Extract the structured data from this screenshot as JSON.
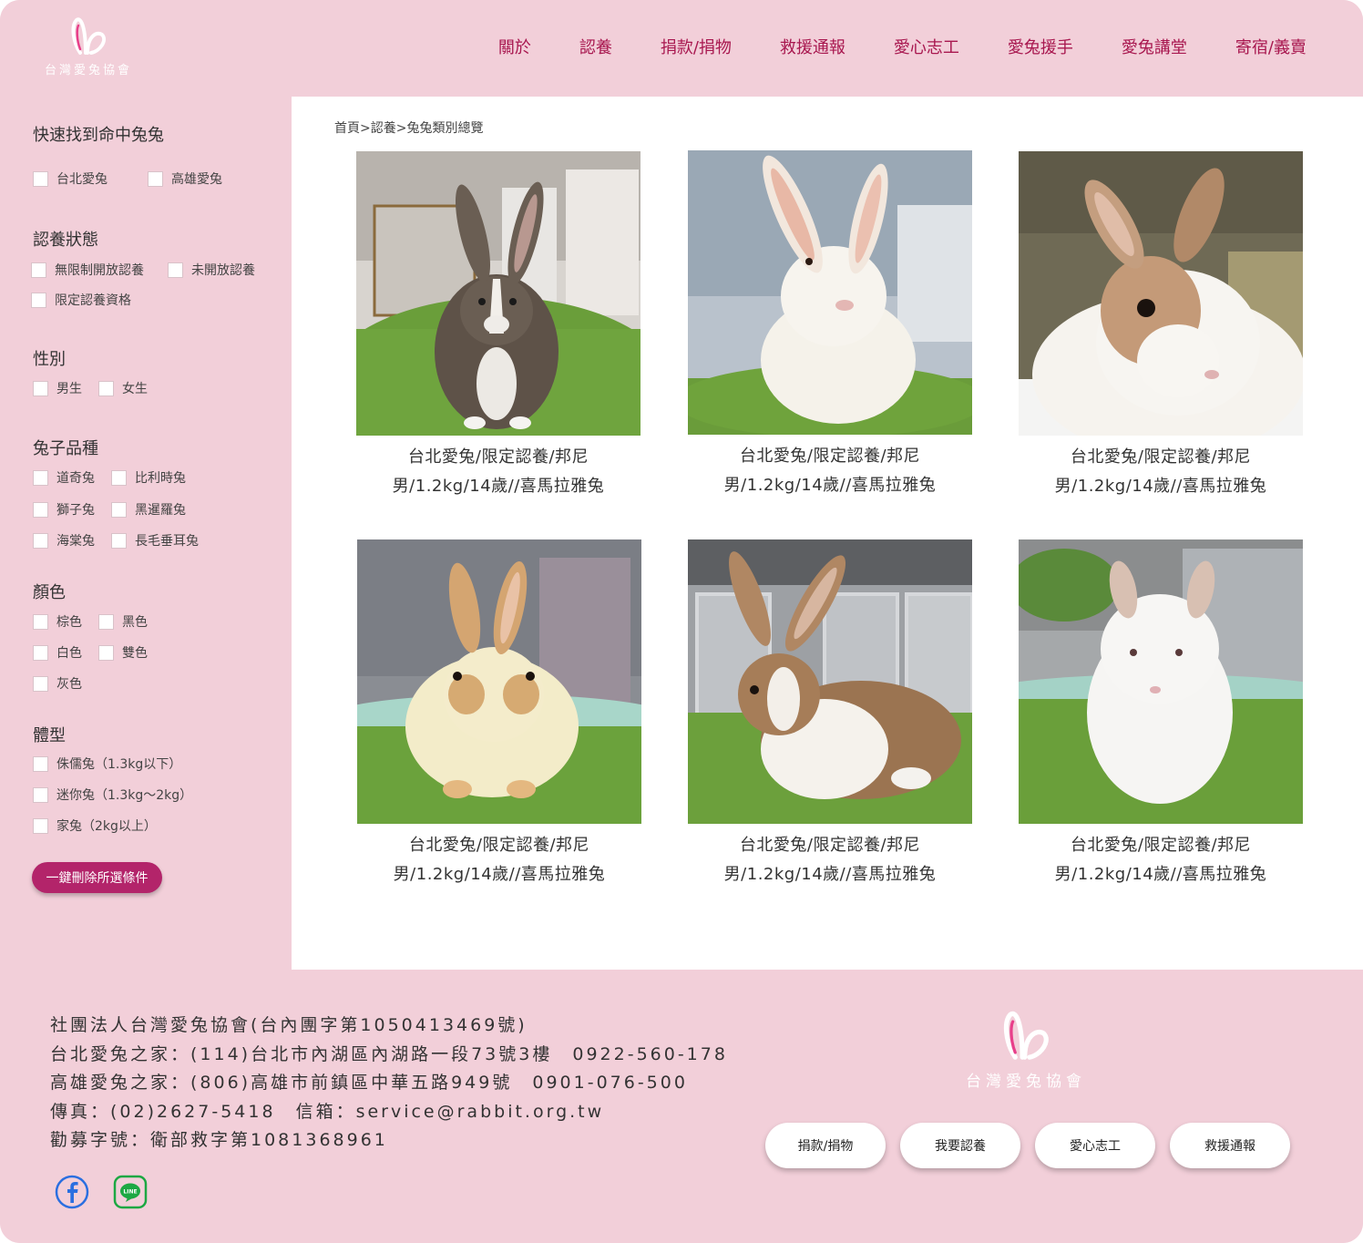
{
  "brand": {
    "name": "台灣愛兔協會",
    "accent": "#a8174f",
    "background": "#f2cfd9",
    "button_color": "#b3246a"
  },
  "nav": [
    "關於",
    "認養",
    "捐款/捐物",
    "救援通報",
    "愛心志工",
    "愛兔援手",
    "愛兔講堂",
    "寄宿/義賣"
  ],
  "breadcrumb": "首頁>認養>兔兔類別總覽",
  "filters": {
    "location": {
      "title": "快速找到命中兔兔",
      "options": [
        "台北愛兔",
        "高雄愛兔"
      ]
    },
    "status": {
      "title": "認養狀態",
      "options": [
        "無限制開放認養",
        "未開放認養",
        "限定認養資格"
      ]
    },
    "gender": {
      "title": "性別",
      "options": [
        "男生",
        "女生"
      ]
    },
    "breed": {
      "title": "兔子品種",
      "options": [
        "道奇兔",
        "比利時兔",
        "獅子兔",
        "黑暹羅兔",
        "海棠兔",
        "長毛垂耳兔"
      ]
    },
    "color": {
      "title": "顏色",
      "options": [
        "棕色",
        "黑色",
        "白色",
        "雙色",
        "灰色"
      ]
    },
    "size": {
      "title": "體型",
      "options": [
        "侏儒兔（1.3kg以下）",
        "迷你兔（1.3kg～2kg）",
        "家兔（2kg以上）"
      ]
    },
    "clear_label": "一鍵刪除所選條件"
  },
  "cards": [
    {
      "line1": "台北愛兔/限定認養/邦尼",
      "line2": "男/1.2kg/14歲//喜馬拉雅兔",
      "photo": "brown-rabbit-photo"
    },
    {
      "line1": "台北愛兔/限定認養/邦尼",
      "line2": "男/1.2kg/14歲//喜馬拉雅兔",
      "photo": "white-rabbit-photo"
    },
    {
      "line1": "台北愛兔/限定認養/邦尼",
      "line2": "男/1.2kg/14歲//喜馬拉雅兔",
      "photo": "tan-white-rabbit-photo"
    },
    {
      "line1": "台北愛兔/限定認養/邦尼",
      "line2": "男/1.2kg/14歲//喜馬拉雅兔",
      "photo": "cream-rabbit-photo"
    },
    {
      "line1": "台北愛兔/限定認養/邦尼",
      "line2": "男/1.2kg/14歲//喜馬拉雅兔",
      "photo": "brown-white-rabbit-photo"
    },
    {
      "line1": "台北愛兔/限定認養/邦尼",
      "line2": "男/1.2kg/14歲//喜馬拉雅兔",
      "photo": "fluffy-white-rabbit-photo"
    }
  ],
  "footer": {
    "lines": [
      "社團法人台灣愛兔協會(台內團字第1050413469號)",
      "台北愛兔之家：(114)台北市內湖區內湖路一段73號3樓　0922-560-178",
      "高雄愛兔之家：(806)高雄市前鎮區中華五路949號　0901-076-500",
      "傳真：(02)2627-5418　信箱：service@rabbit.org.tw",
      "勸募字號：衛部救字第1081368961"
    ],
    "social": [
      "facebook-icon",
      "line-icon"
    ],
    "buttons": [
      "捐款/捐物",
      "我要認養",
      "愛心志工",
      "救援通報"
    ]
  }
}
